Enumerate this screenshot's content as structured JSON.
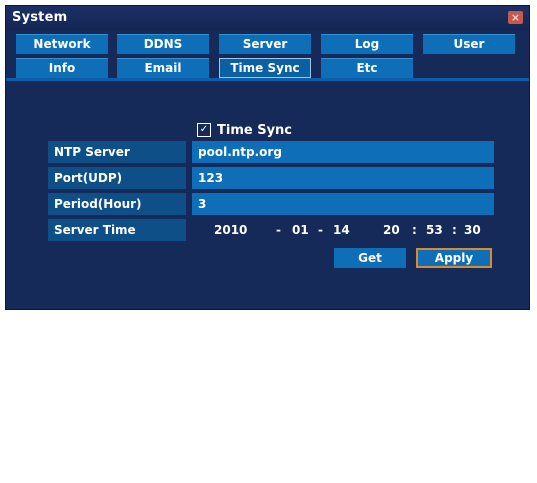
{
  "window": {
    "title": "System",
    "close_glyph": "×"
  },
  "tabs": {
    "row1": [
      "Network",
      "DDNS",
      "Server",
      "Log",
      "User"
    ],
    "row2": [
      "Info",
      "Email",
      "Time Sync",
      "Etc"
    ],
    "active": "Time Sync"
  },
  "time_sync": {
    "checkbox_label": "Time Sync",
    "checked": true,
    "check_glyph": "✓"
  },
  "fields": {
    "ntp_server": {
      "label": "NTP Server",
      "value": "pool.ntp.org"
    },
    "port": {
      "label": "Port(UDP)",
      "value": "123"
    },
    "period": {
      "label": "Period(Hour)",
      "value": "3"
    },
    "server_time": {
      "label": "Server Time",
      "year": "2010",
      "sep_date": "-",
      "month": "01",
      "day": "14",
      "hour": "20",
      "sep_time": ":",
      "minute": "53",
      "second": "30"
    }
  },
  "buttons": {
    "get": "Get",
    "apply": "Apply"
  },
  "colors": {
    "window_bg": "#152a59",
    "tab_bg": "#0e6fb8",
    "label_bg": "#0f4f87",
    "apply_border": "#d98a2b",
    "close_bg": "#c45a4f"
  }
}
